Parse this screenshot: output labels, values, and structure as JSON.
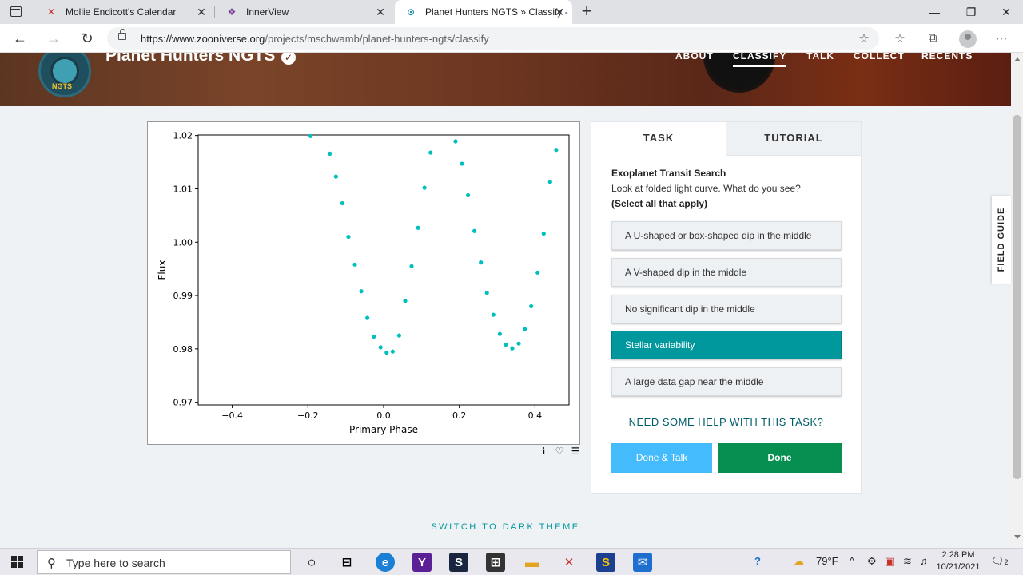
{
  "browser": {
    "tabs": [
      {
        "title": "Mollie Endicott's Calendar",
        "favicon": "calendar-x-icon",
        "active": false
      },
      {
        "title": "InnerView",
        "favicon": "innerview-icon",
        "active": false
      },
      {
        "title": "Planet Hunters NGTS » Classify -",
        "favicon": "zooniverse-icon",
        "active": true
      }
    ],
    "url_host": "https://www.zooniverse.org",
    "url_path": "/projects/mschwamb/planet-hunters-ngts/classify"
  },
  "header": {
    "logo_text": "NGTS",
    "project_title": "Planet Hunters NGTS",
    "verified_glyph": "✓",
    "nav": [
      {
        "label": "ABOUT",
        "active": false
      },
      {
        "label": "CLASSIFY",
        "active": true
      },
      {
        "label": "TALK",
        "active": false
      },
      {
        "label": "COLLECT",
        "active": false
      },
      {
        "label": "RECENTS",
        "active": false
      }
    ]
  },
  "chart_data": {
    "type": "scatter",
    "title": "",
    "xlabel": "Primary Phase",
    "ylabel": "Flux",
    "xlim": [
      -0.49,
      0.49
    ],
    "ylim": [
      0.9695,
      1.0201
    ],
    "xticks": [
      -0.4,
      -0.2,
      0.0,
      0.2,
      0.4
    ],
    "xtick_labels": [
      "−0.4",
      "−0.2",
      "0.0",
      "0.2",
      "0.4"
    ],
    "yticks": [
      0.97,
      0.98,
      0.99,
      1.0,
      1.01,
      1.02
    ],
    "ytick_labels": [
      "0.97",
      "0.98",
      "0.99",
      "1.00",
      "1.01",
      "1.02"
    ],
    "grid": false,
    "color": "#00bfbf",
    "x": [
      -0.193,
      -0.142,
      -0.126,
      -0.109,
      -0.093,
      -0.076,
      -0.059,
      -0.043,
      -0.026,
      -0.008,
      0.008,
      0.024,
      0.041,
      0.057,
      0.074,
      0.091,
      0.108,
      0.124,
      0.19,
      0.207,
      0.223,
      0.24,
      0.257,
      0.273,
      0.29,
      0.307,
      0.323,
      0.34,
      0.357,
      0.373,
      0.39,
      0.407,
      0.423,
      0.44,
      0.456
    ],
    "y": [
      1.0199,
      1.0166,
      1.0123,
      1.0073,
      1.001,
      0.9958,
      0.9908,
      0.9858,
      0.9823,
      0.9803,
      0.9793,
      0.9795,
      0.9825,
      0.989,
      0.9955,
      1.0027,
      1.0102,
      1.0168,
      1.0189,
      1.0147,
      1.0088,
      1.0021,
      0.9962,
      0.9905,
      0.9864,
      0.9828,
      0.9808,
      0.9801,
      0.981,
      0.9837,
      0.988,
      0.9943,
      1.0016,
      1.0113,
      1.0173
    ]
  },
  "plot_tools": [
    {
      "name": "info-icon",
      "glyph": "ℹ"
    },
    {
      "name": "favorite-heart-icon",
      "glyph": "♡"
    },
    {
      "name": "collection-list-icon",
      "glyph": "☰"
    }
  ],
  "task": {
    "tab_task": "TASK",
    "tab_tutorial": "TUTORIAL",
    "title": "Exoplanet Transit Search",
    "question": "Look at folded light curve. What do you see?",
    "note": "(Select all that apply)",
    "answers": [
      {
        "label": "A U-shaped or box-shaped dip in the middle",
        "selected": false
      },
      {
        "label": "A V-shaped dip in the middle",
        "selected": false
      },
      {
        "label": "No significant dip in the middle",
        "selected": false
      },
      {
        "label": "Stellar variability",
        "selected": true
      },
      {
        "label": "A large data gap near the middle",
        "selected": false
      }
    ],
    "help": "NEED SOME HELP WITH THIS TASK?",
    "done_talk": "Done & Talk",
    "done": "Done"
  },
  "field_guide": "FIELD GUIDE",
  "dark_theme": "SWITCH TO DARK THEME",
  "taskbar": {
    "search_placeholder": "Type here to search",
    "weather": "79°F",
    "time": "2:28 PM",
    "date": "10/21/2021",
    "notification_count": "2"
  },
  "colors": {
    "accent_teal": "#00979d",
    "done_green": "#078f52",
    "done_talk_blue": "#43bbfd",
    "plot_points": "#00bfbf"
  }
}
